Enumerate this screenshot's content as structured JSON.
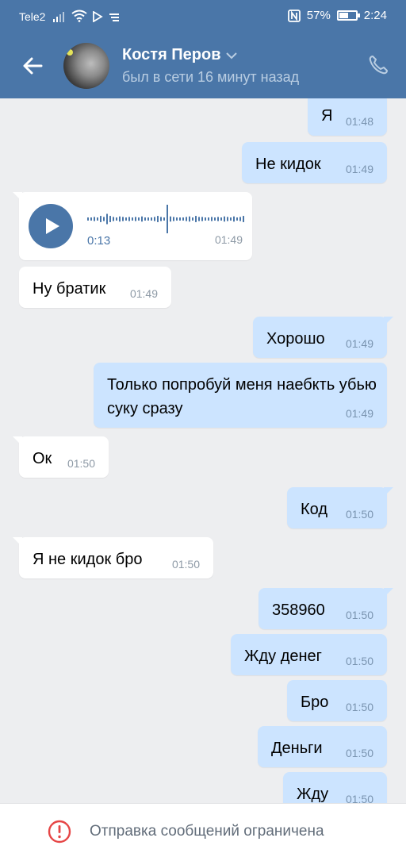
{
  "status_bar": {
    "carrier": "Tele2",
    "battery_pct": "57%",
    "battery_level": 0.57,
    "time": "2:24",
    "icons": [
      "signal-icon",
      "wifi-icon",
      "play-store-icon",
      "data-saver-icon",
      "nfc-icon",
      "battery-icon"
    ]
  },
  "header": {
    "name": "Костя Перов",
    "status": "был в сети 16 минут назад",
    "icons": [
      "back-arrow-icon",
      "avatar",
      "chevron-down-icon",
      "phone-icon"
    ],
    "accent": "#4a76a8"
  },
  "messages": [
    {
      "dir": "out",
      "text": "Я",
      "time": "01:48"
    },
    {
      "dir": "out",
      "text": "Не кидок",
      "time": "01:49"
    },
    {
      "dir": "in",
      "type": "voice",
      "duration": "0:13",
      "time": "01:49"
    },
    {
      "dir": "in",
      "text": "Ну братик",
      "time": "01:49"
    },
    {
      "dir": "out",
      "text": "Хорошо",
      "time": "01:49"
    },
    {
      "dir": "out",
      "text": "Только попробуй меня наебкть убью суку сразу",
      "time": "01:49"
    },
    {
      "dir": "in",
      "text": "Ок",
      "time": "01:50"
    },
    {
      "dir": "out",
      "text": "Код",
      "time": "01:50"
    },
    {
      "dir": "in",
      "text": "Я не кидок бро",
      "time": "01:50"
    },
    {
      "dir": "out",
      "text": "358960",
      "time": "01:50"
    },
    {
      "dir": "out",
      "text": "Жду денег",
      "time": "01:50"
    },
    {
      "dir": "out",
      "text": "Бро",
      "time": "01:50"
    },
    {
      "dir": "out",
      "text": "Деньги",
      "time": "01:50"
    },
    {
      "dir": "out",
      "text": "Жду",
      "time": "01:50"
    }
  ],
  "bottom_bar": {
    "text": "Отправка сообщений ограничена",
    "icon": "warning-circle-icon",
    "warn_color": "#e64646"
  },
  "colors": {
    "outgoing_bubble": "#cce4ff",
    "incoming_bubble": "#ffffff",
    "background": "#edeef0"
  }
}
